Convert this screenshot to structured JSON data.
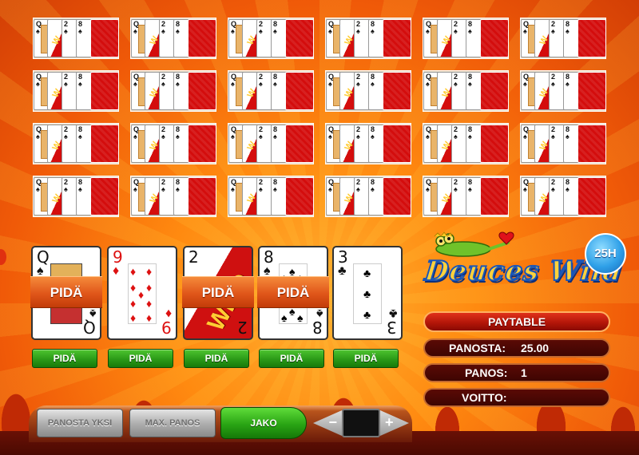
{
  "game": {
    "title": "Deuces Wild",
    "badge": "25H"
  },
  "mini_hands": {
    "rows": 4,
    "columns": 6,
    "cards": [
      {
        "rank": "Q",
        "suit": "♠"
      },
      {
        "rank": "",
        "suit": "",
        "wild": true
      },
      {
        "rank": "2",
        "suit": "♠"
      },
      {
        "rank": "8",
        "suit": "♠"
      },
      {
        "rank": "",
        "suit": "",
        "back": true
      }
    ]
  },
  "hand": {
    "cards": [
      {
        "rank": "Q",
        "suit": "♠",
        "color": "black",
        "held": true,
        "type": "queen"
      },
      {
        "rank": "9",
        "suit": "♦",
        "color": "red",
        "held": false,
        "type": "pips"
      },
      {
        "rank": "2",
        "suit": "",
        "color": "black",
        "held": true,
        "type": "wild"
      },
      {
        "rank": "8",
        "suit": "♠",
        "color": "black",
        "held": true,
        "type": "pips"
      },
      {
        "rank": "3",
        "suit": "♣",
        "color": "black",
        "held": false,
        "type": "pips"
      }
    ],
    "held_label": "PIDÄ",
    "hold_button_label": "PIDÄ"
  },
  "info": {
    "paytable_label": "PAYTABLE",
    "bet_total_label": "PANOSTA:",
    "bet_total_value": "25.00",
    "bet_label": "PANOS:",
    "bet_value": "1",
    "win_label": "VOITTO:",
    "win_value": ""
  },
  "controls": {
    "bet_one_label": "PANOSTA YKSI",
    "max_bet_label": "MAX. PANOS",
    "deal_label": "JAKO",
    "minus_label": "−",
    "plus_label": "+"
  },
  "colors": {
    "accent_green": "#2b9a18",
    "panel_dark": "#3e0502",
    "card_back_red": "#d40d0d",
    "background_orange": "#ff8a10"
  }
}
